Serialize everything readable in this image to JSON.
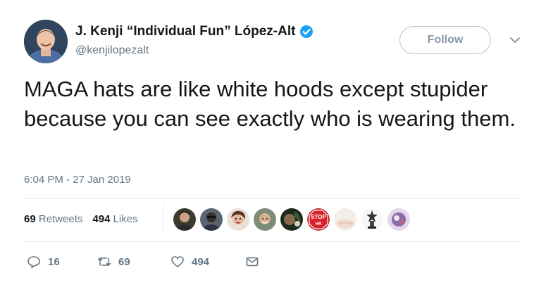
{
  "author": {
    "name": "J. Kenji “Individual Fun” López-Alt",
    "handle": "@kenjilopezalt"
  },
  "follow_label": "Follow",
  "tweet": {
    "text": "MAGA hats are like white hoods except stupider because you can see exactly who is wearing them.",
    "timestamp": "6:04 PM - 27 Jan 2019"
  },
  "stats": {
    "retweets_count": "69",
    "retweets_label": "Retweets",
    "likes_count": "494",
    "likes_label": "Likes"
  },
  "likers": [
    {
      "icon": "liker-avatar-1"
    },
    {
      "icon": "liker-avatar-2"
    },
    {
      "icon": "liker-avatar-3"
    },
    {
      "icon": "liker-avatar-4"
    },
    {
      "icon": "liker-avatar-5"
    },
    {
      "icon": "liker-avatar-stop-sign",
      "text_top": "STOP",
      "text_bottom": "HR"
    },
    {
      "icon": "liker-avatar-7"
    },
    {
      "icon": "liker-avatar-8"
    },
    {
      "icon": "liker-avatar-9"
    }
  ],
  "actions": {
    "reply_count": "16",
    "retweet_count": "69",
    "like_count": "494"
  },
  "colors": {
    "verified": "#1da1f2",
    "text_primary": "#14171a",
    "text_secondary": "#657786",
    "divider": "#e6ecf0"
  }
}
